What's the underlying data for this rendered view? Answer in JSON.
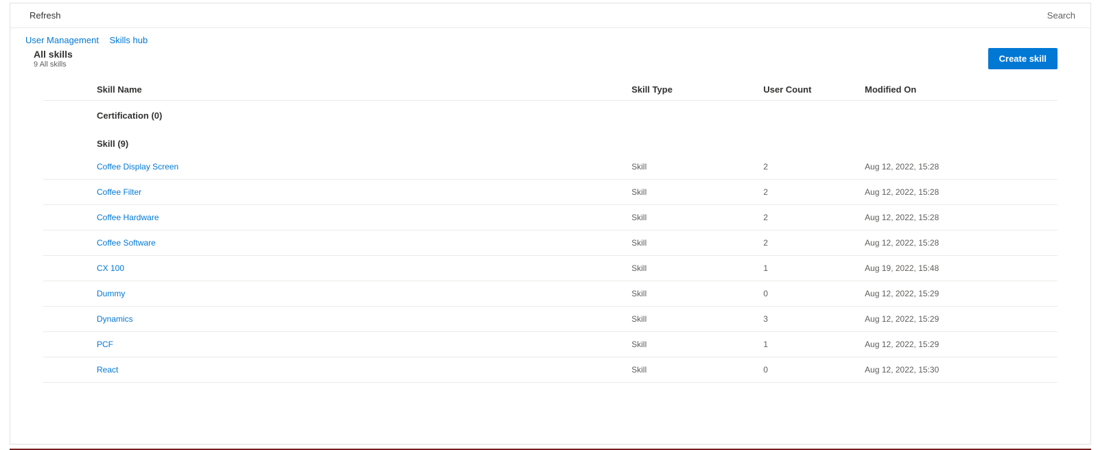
{
  "commandBar": {
    "refresh": "Refresh",
    "search": "Search"
  },
  "breadcrumb": {
    "item1": "User Management",
    "item2": "Skills hub"
  },
  "header": {
    "title": "All skills",
    "subtitle": "9 All skills",
    "createBtn": "Create skill"
  },
  "columns": {
    "name": "Skill Name",
    "type": "Skill Type",
    "count": "User Count",
    "modified": "Modified On"
  },
  "groups": {
    "cert": "Certification (0)",
    "skill": "Skill (9)"
  },
  "rows": [
    {
      "name": "Coffee Display Screen",
      "type": "Skill",
      "count": "2",
      "modified": "Aug 12, 2022, 15:28"
    },
    {
      "name": "Coffee Filter",
      "type": "Skill",
      "count": "2",
      "modified": "Aug 12, 2022, 15:28"
    },
    {
      "name": "Coffee Hardware",
      "type": "Skill",
      "count": "2",
      "modified": "Aug 12, 2022, 15:28"
    },
    {
      "name": "Coffee Software",
      "type": "Skill",
      "count": "2",
      "modified": "Aug 12, 2022, 15:28"
    },
    {
      "name": "CX 100",
      "type": "Skill",
      "count": "1",
      "modified": "Aug 19, 2022, 15:48"
    },
    {
      "name": "Dummy",
      "type": "Skill",
      "count": "0",
      "modified": "Aug 12, 2022, 15:29"
    },
    {
      "name": "Dynamics",
      "type": "Skill",
      "count": "3",
      "modified": "Aug 12, 2022, 15:29"
    },
    {
      "name": "PCF",
      "type": "Skill",
      "count": "1",
      "modified": "Aug 12, 2022, 15:29"
    },
    {
      "name": "React",
      "type": "Skill",
      "count": "0",
      "modified": "Aug 12, 2022, 15:30"
    }
  ]
}
